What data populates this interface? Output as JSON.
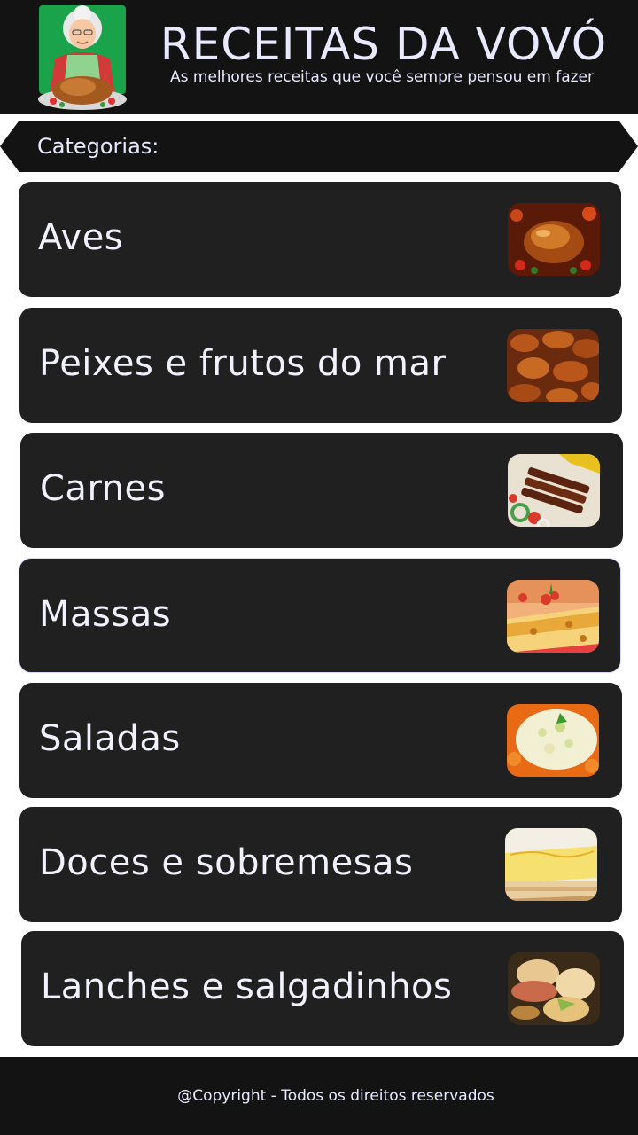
{
  "header": {
    "title": "RECEITAS DA VOVÓ",
    "subtitle": "As melhores receitas que você sempre pensou em fazer",
    "logo_icon": "grandma-with-roast-chicken-logo"
  },
  "categories_label": "Categorias:",
  "categories": [
    {
      "label": "Aves",
      "image": "roast-chicken-image"
    },
    {
      "label": "Peixes e frutos do mar",
      "image": "fried-shrimp-image"
    },
    {
      "label": "Carnes",
      "image": "meat-skewers-image"
    },
    {
      "label": "Massas",
      "image": "baked-pasta-image",
      "selected": true
    },
    {
      "label": "Saladas",
      "image": "potato-salad-image"
    },
    {
      "label": "Doces e sobremesas",
      "image": "layered-dessert-image"
    },
    {
      "label": "Lanches e salgadinhos",
      "image": "savory-snacks-image"
    }
  ],
  "footer": {
    "copyright": "@Copyright - Todos os direitos reservados"
  },
  "colors": {
    "background": "#131313",
    "card": "#202020",
    "text": "#e9e9ff"
  }
}
